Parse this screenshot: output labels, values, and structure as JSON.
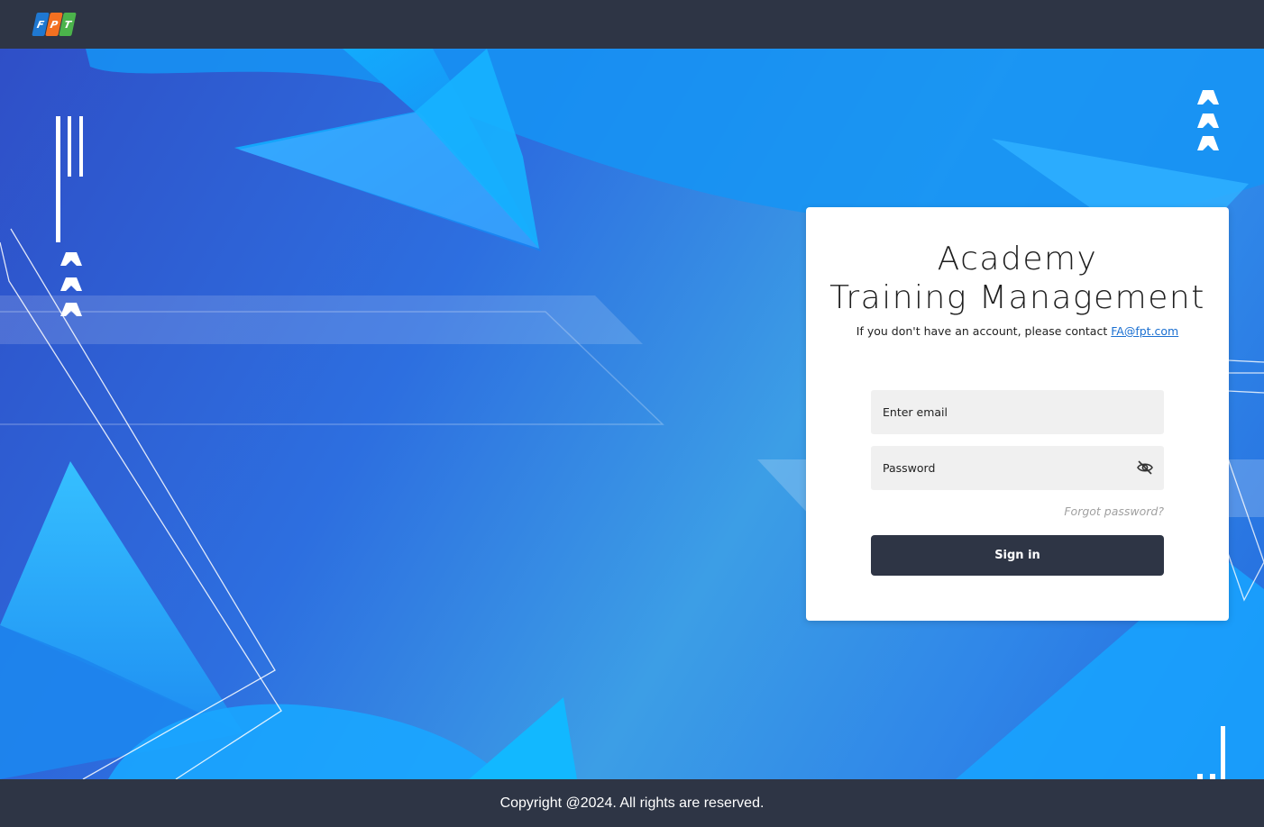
{
  "brand": {
    "logo_letters": [
      "F",
      "P",
      "T"
    ],
    "colors": {
      "blue": "#1f78d1",
      "orange": "#f37021",
      "green": "#4bb34b"
    }
  },
  "login": {
    "title_line1": "Academy",
    "title_line2": "Training Management",
    "contact_text": "If you don't have an account, please contact",
    "contact_email": "FA@fpt.com",
    "email_placeholder": "Enter email",
    "password_placeholder": "Password",
    "password_toggle_icon": "eye-slash-icon",
    "forgot_label": "Forgot password?",
    "signin_label": "Sign in"
  },
  "footer": {
    "copyright": "Copyright @2024. All rights are reserved."
  },
  "theme": {
    "bar_color": "#2e3545",
    "card_color": "#ffffff",
    "link_color": "#1a6fd1",
    "field_bg": "#f0f0f0"
  }
}
